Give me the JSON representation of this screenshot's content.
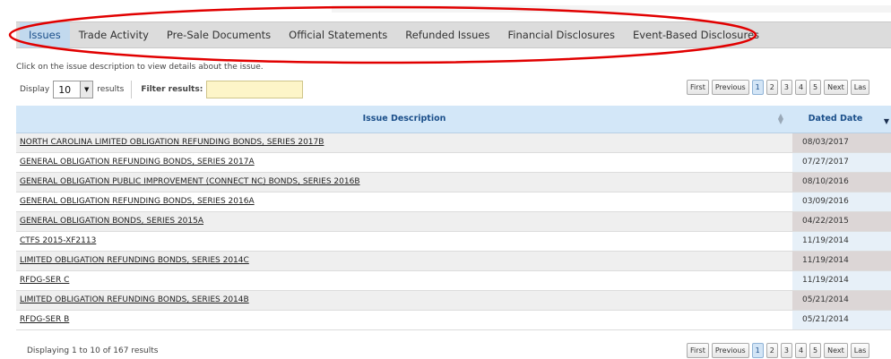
{
  "tabs": [
    {
      "label": "Issues",
      "active": true
    },
    {
      "label": "Trade Activity",
      "active": false
    },
    {
      "label": "Pre-Sale Documents",
      "active": false
    },
    {
      "label": "Official Statements",
      "active": false
    },
    {
      "label": "Refunded Issues",
      "active": false
    },
    {
      "label": "Financial Disclosures",
      "active": false
    },
    {
      "label": "Event-Based Disclosures",
      "active": false
    }
  ],
  "annotation_color": "#e10000",
  "hint": "Click on the issue description to view details about the issue.",
  "controls": {
    "display_label": "Display",
    "display_value": "10",
    "results_label": "results",
    "filter_label": "Filter results:",
    "filter_value": ""
  },
  "pager": {
    "first": "First",
    "previous": "Previous",
    "pages": [
      "1",
      "2",
      "3",
      "4",
      "5"
    ],
    "current_page": "1",
    "next": "Next",
    "last": "Las"
  },
  "table": {
    "columns": [
      "Issue Description",
      "Dated Date"
    ],
    "rows": [
      {
        "description": "NORTH CAROLINA LIMITED OBLIGATION REFUNDING BONDS, SERIES 2017B",
        "date": "08/03/2017"
      },
      {
        "description": "GENERAL OBLIGATION REFUNDING BONDS, SERIES 2017A",
        "date": "07/27/2017"
      },
      {
        "description": "GENERAL OBLIGATION PUBLIC IMPROVEMENT (CONNECT NC) BONDS, SERIES 2016B",
        "date": "08/10/2016"
      },
      {
        "description": "GENERAL OBLIGATION REFUNDING BONDS, SERIES 2016A",
        "date": "03/09/2016"
      },
      {
        "description": "GENERAL OBLIGATION BONDS, SERIES 2015A",
        "date": "04/22/2015"
      },
      {
        "description": "CTFS 2015-XF2113",
        "date": "11/19/2014"
      },
      {
        "description": "LIMITED OBLIGATION REFUNDING BONDS, SERIES 2014C",
        "date": "11/19/2014"
      },
      {
        "description": "RFDG-SER C",
        "date": "11/19/2014"
      },
      {
        "description": "LIMITED OBLIGATION REFUNDING BONDS, SERIES 2014B",
        "date": "05/21/2014"
      },
      {
        "description": "RFDG-SER B",
        "date": "05/21/2014"
      }
    ]
  },
  "summary": "Displaying 1 to 10 of 167 results"
}
